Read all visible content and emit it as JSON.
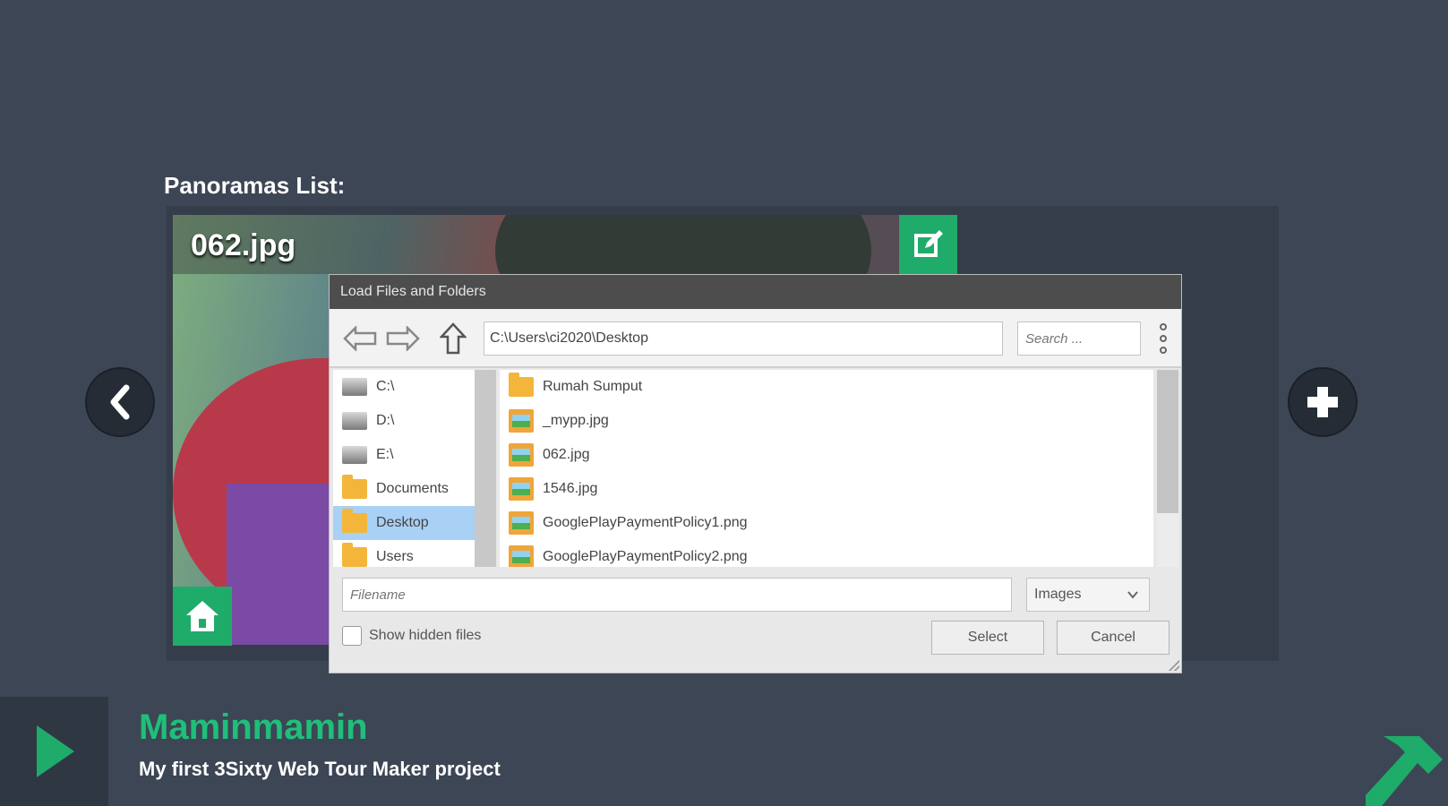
{
  "panel": {
    "title": "Panoramas List:"
  },
  "panorama": {
    "name": "062.jpg"
  },
  "dialog": {
    "title": "Load Files and Folders",
    "path": "C:\\Users\\ci2020\\Desktop",
    "search_placeholder": "Search ...",
    "drives": [
      {
        "label": "C:\\",
        "icon": "drive-icon"
      },
      {
        "label": "D:\\",
        "icon": "drive-icon"
      },
      {
        "label": "E:\\",
        "icon": "drive-icon"
      },
      {
        "label": "Documents",
        "icon": "folder-icon"
      },
      {
        "label": "Desktop",
        "icon": "folder-icon",
        "selected": true
      },
      {
        "label": "Users",
        "icon": "folder-icon"
      }
    ],
    "files": [
      {
        "label": "Rumah Sumput",
        "icon": "folder-icon"
      },
      {
        "label": "_mypp.jpg",
        "icon": "image-icon"
      },
      {
        "label": "062.jpg",
        "icon": "image-icon"
      },
      {
        "label": "1546.jpg",
        "icon": "image-icon"
      },
      {
        "label": "GooglePlayPaymentPolicy1.png",
        "icon": "image-icon"
      },
      {
        "label": "GooglePlayPaymentPolicy2.png",
        "icon": "image-icon"
      }
    ],
    "filename_placeholder": "Filename",
    "filter": "Images",
    "show_hidden_label": "Show hidden files",
    "select_label": "Select",
    "cancel_label": "Cancel"
  },
  "project": {
    "name": "Maminmamin",
    "description": "My first 3Sixty Web Tour Maker project"
  },
  "colors": {
    "accent": "#1fab6a",
    "background": "#3d4655",
    "dialog_title": "#4d4d4d"
  }
}
